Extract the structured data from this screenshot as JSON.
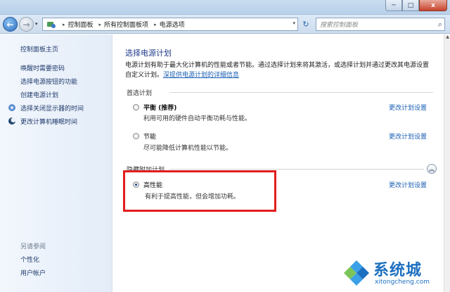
{
  "titlebar": {
    "minimize": "─",
    "maximize": "□",
    "close": "x"
  },
  "nav": {
    "back_glyph": "←",
    "fwd_glyph": "→",
    "dropdown_glyph": "▾",
    "address_icon": "control-panel-icon",
    "breadcrumbs": [
      "控制面板",
      "所有控制面板项",
      "电源选项"
    ],
    "refresh_glyph": "↻",
    "search_placeholder": "搜索控制面板",
    "search_glyph": "⌕"
  },
  "sidebar": {
    "home": "控制面板主页",
    "links": [
      {
        "label": "唤醒时需要密码",
        "icon": ""
      },
      {
        "label": "选择电源按钮的功能",
        "icon": ""
      },
      {
        "label": "创建电源计划",
        "icon": ""
      },
      {
        "label": "选择关闭显示器的时间",
        "icon": "display-icon"
      },
      {
        "label": "更改计算机睡眠时间",
        "icon": "moon-icon"
      }
    ],
    "see_also_label": "另请参阅",
    "see_also": [
      "个性化",
      "用户帐户"
    ]
  },
  "main": {
    "title": "选择电源计划",
    "desc_line1": "电源计划有助于最大化计算机的性能或者节能。通过选择计划来将其激活，或选择计划并通过更改其电源设置",
    "desc_line2_prefix": "自定义计划。",
    "desc_link": "深提供电源计划的详细信息",
    "preferred_label": "首选计划",
    "hidden_label": "隐藏附加计划",
    "plans": [
      {
        "name": "平衡 (推荐)",
        "desc": "利用可用的硬件自动平衡功耗与性能。",
        "link": "更改计划设置",
        "selected": false
      },
      {
        "name": "节能",
        "desc": "尽可能降低计算机性能以节能。",
        "link": "更改计划设置",
        "selected": false
      },
      {
        "name": "高性能",
        "desc": "有利于提高性能，但会增加功耗。",
        "link": "更改计划设置",
        "selected": true
      }
    ],
    "collapse_glyph": "︽"
  },
  "watermark": {
    "text": "系统城",
    "url": "xitongcheng.com"
  },
  "colors": {
    "accent": "#1a5fb4",
    "highlight": "#e11d1d",
    "title": "#1e3a8a"
  }
}
